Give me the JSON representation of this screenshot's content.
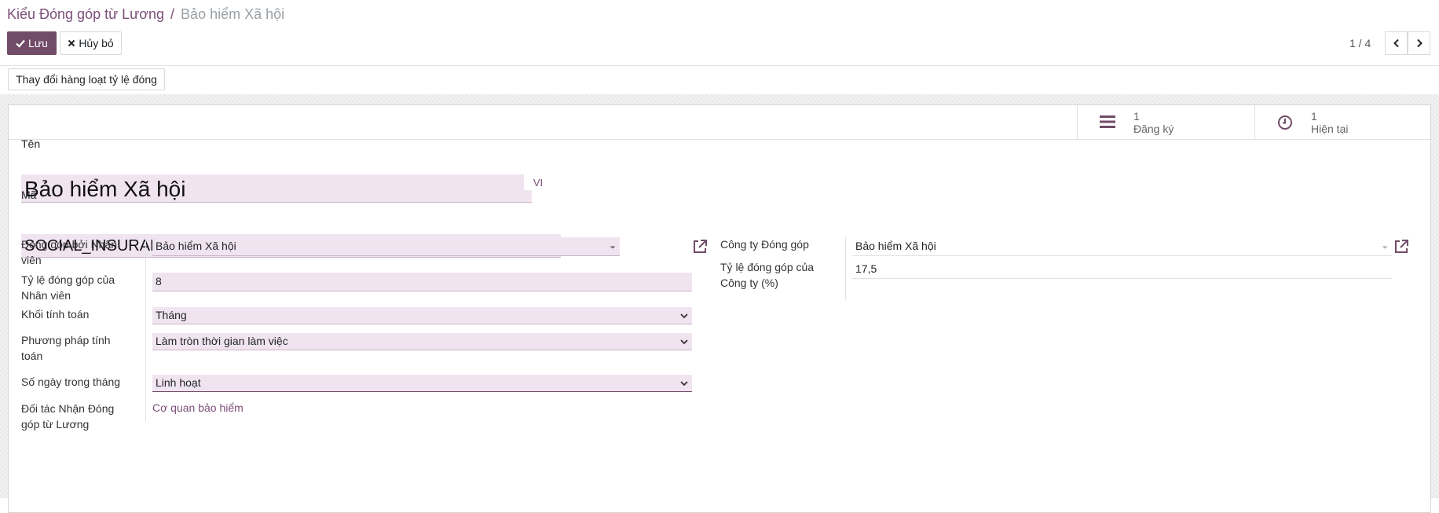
{
  "breadcrumb": {
    "parent": "Kiểu Đóng góp từ Lương",
    "separator": "/",
    "current": "Bảo hiểm Xã hội"
  },
  "toolbar": {
    "save_label": "Lưu",
    "cancel_label": "Hủy bỏ",
    "mass_change_label": "Thay đổi hàng loạt tỷ lệ đóng"
  },
  "pager": {
    "text": "1 / 4"
  },
  "stats": [
    {
      "icon": "list-icon",
      "count": "1",
      "label": "Đăng ký"
    },
    {
      "icon": "clock-icon",
      "count": "1",
      "label": "Hiện tại"
    }
  ],
  "form": {
    "name_label": "Tên",
    "name_value": "Bảo hiểm Xã hội",
    "lang_label": "VI",
    "code_label": "Mã",
    "code_value": "SOCIAL_INSURANCE",
    "left": {
      "employee_contrib_label": "Đóng góp bởi Nhân viên",
      "employee_contrib_value": "Bảo hiểm Xã hội",
      "employee_rate_label": "Tỷ lệ đóng góp của Nhân viên",
      "employee_rate_value": "8",
      "computation_block_label": "Khối tính toán",
      "computation_block_value": "Tháng",
      "computation_method_label": "Phương pháp tính toán",
      "computation_method_value": "Làm tròn thời gian làm việc",
      "days_in_month_label": "Số ngày trong tháng",
      "days_in_month_value": "Linh hoạt",
      "partner_label": "Đối tác Nhận Đóng góp từ Lương",
      "partner_value": "Cơ quan bảo hiểm"
    },
    "right": {
      "company_contrib_label": "Công ty Đóng góp",
      "company_contrib_value": "Bảo hiểm Xã hội",
      "company_rate_label": "Tỷ lệ đóng góp của Công ty (%)",
      "company_rate_value": "17,5"
    }
  },
  "colors": {
    "brand": "#714b67",
    "link": "#7c4f7a",
    "field_bg": "#f1e4f1"
  }
}
